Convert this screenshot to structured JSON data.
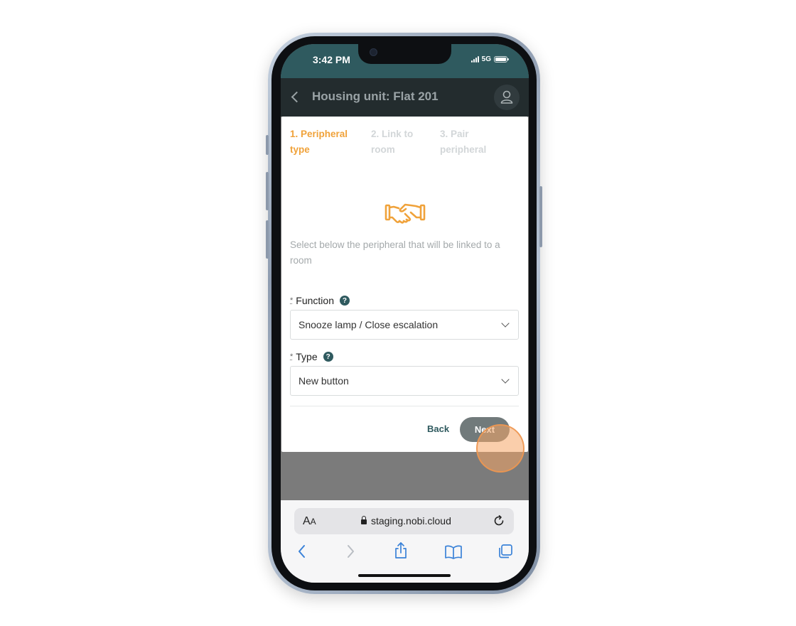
{
  "status_bar": {
    "time": "3:42 PM",
    "network": "5G"
  },
  "header": {
    "title": "Housing unit: Flat 201"
  },
  "steps": [
    {
      "line1": "1. Peripheral",
      "line2": "type",
      "state": "active"
    },
    {
      "line1": "2. Link to",
      "line2": "room",
      "state": "inactive"
    },
    {
      "line1": "3. Pair",
      "line2": "peripheral",
      "state": "inactive"
    }
  ],
  "intro_text": "Select below the peripheral that will be linked to a room",
  "form": {
    "function": {
      "required_mark": "*",
      "label": "Function",
      "help": "?",
      "value": "Snooze lamp / Close escalation"
    },
    "type": {
      "required_mark": "*",
      "label": "Type",
      "help": "?",
      "value": "New button"
    }
  },
  "actions": {
    "back": "Back",
    "next": "Next"
  },
  "browser": {
    "text_size": "A",
    "text_size_small": "A",
    "url": "staging.nobi.cloud"
  },
  "colors": {
    "accent": "#f0a23a",
    "primary": "#2f5a5f",
    "header_bg": "#232c2e"
  }
}
